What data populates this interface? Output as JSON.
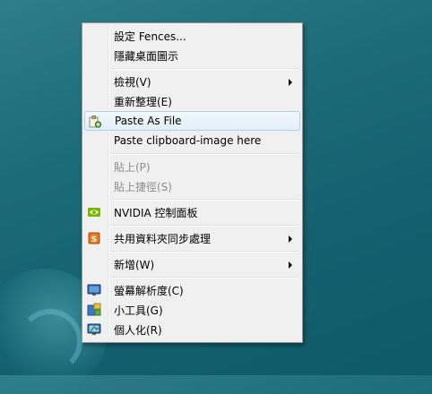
{
  "menu": {
    "items": [
      {
        "label": "設定 Fences..."
      },
      {
        "label": "隱藏桌面圖示"
      },
      {
        "label": "檢視(V)"
      },
      {
        "label": "重新整理(E)"
      },
      {
        "label": "Paste As File",
        "icon": "paste-file-icon"
      },
      {
        "label": "Paste clipboard-image here"
      },
      {
        "label": "貼上(P)"
      },
      {
        "label": "貼上捷徑(S)"
      },
      {
        "label": "NVIDIA 控制面板",
        "icon": "nvidia-icon"
      },
      {
        "label": "共用資料夾同步處理",
        "icon": "sync-icon"
      },
      {
        "label": "新增(W)"
      },
      {
        "label": "螢幕解析度(C)",
        "icon": "monitor-icon"
      },
      {
        "label": "小工具(G)",
        "icon": "gadgets-icon"
      },
      {
        "label": "個人化(R)",
        "icon": "personalize-icon"
      }
    ]
  },
  "colors": {
    "nvidia": "#76b900",
    "sync": "#e87a1e",
    "highlight_border": "#a8d0ef"
  }
}
